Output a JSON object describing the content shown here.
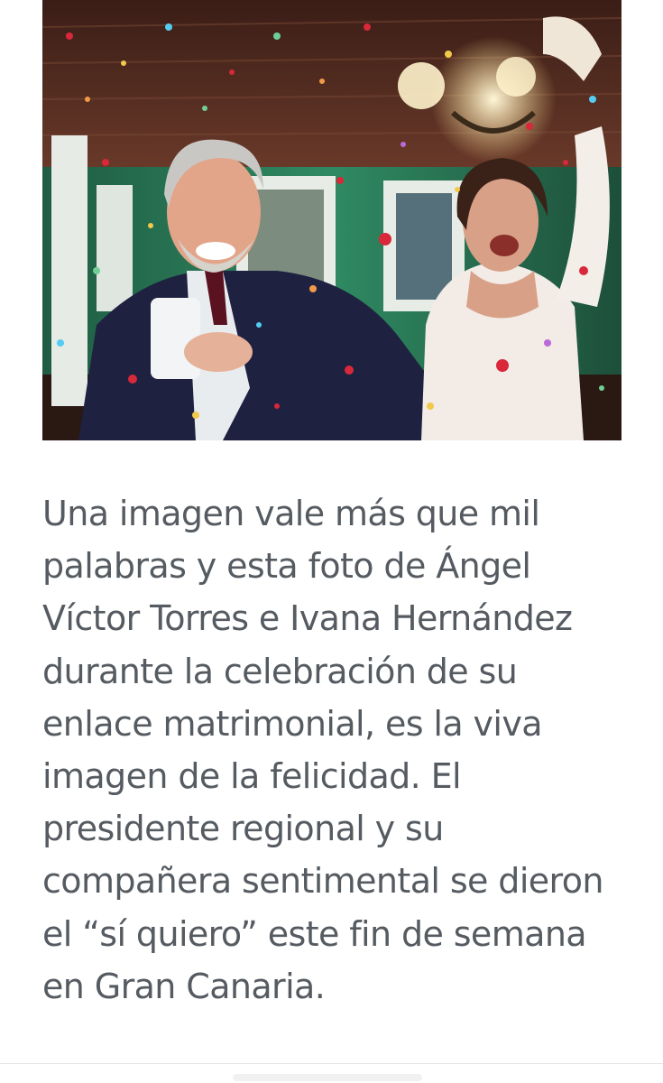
{
  "article": {
    "body": "Una imagen vale más que mil palabras y esta foto de Ángel Víctor Torres e Ivana Hernández durante la celebración de su enlace matrimonial, es la viva imagen de la felicidad. El presidente regional y su compañera sentimental se dieron el “sí quiero” este fin de semana en Gran Canaria."
  },
  "photo": {
    "subject": "wedding-couple-confetti-photo",
    "colors": {
      "ceiling": "#5a2e22",
      "wall_green": "#2f8a62",
      "suit": "#1e2140",
      "dress": "#f2ebe6",
      "confetti_red": "#d8283a"
    }
  },
  "colors": {
    "text": "#555b61",
    "background": "#ffffff"
  }
}
